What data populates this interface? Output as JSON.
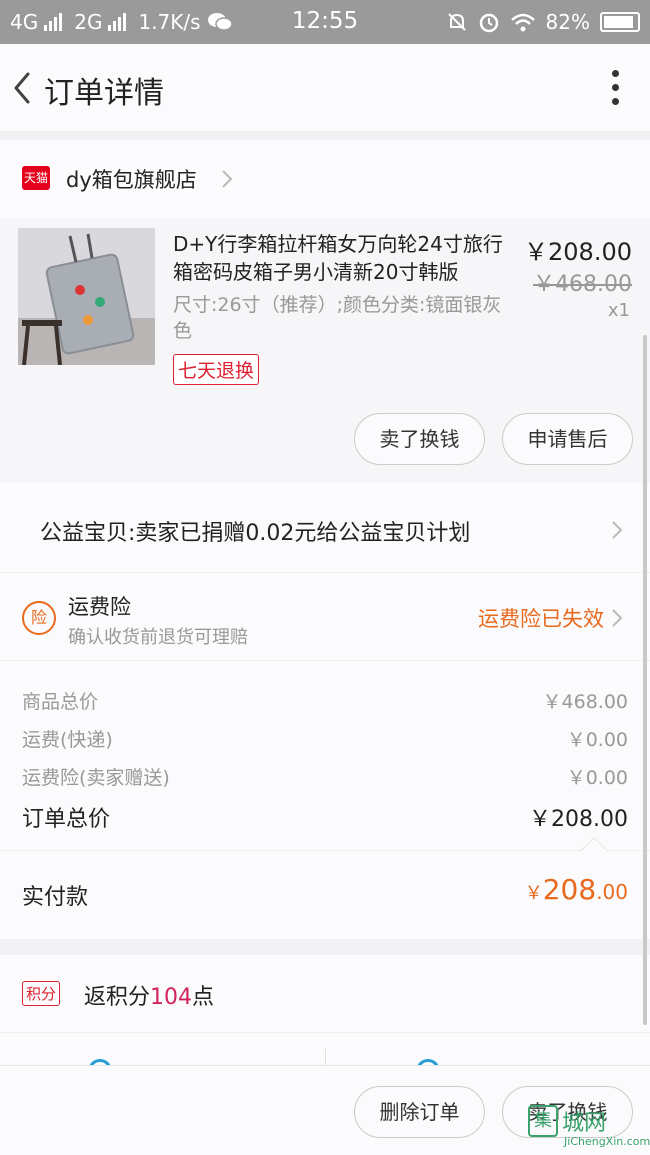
{
  "status_bar": {
    "net1": "4G",
    "net2": "2G",
    "speed": "1.7K/s",
    "time": "12:55",
    "battery": "82%"
  },
  "header": {
    "title": "订单详情"
  },
  "store": {
    "badge": "天猫",
    "name": "dy箱包旗舰店"
  },
  "product": {
    "title": "D+Y行李箱拉杆箱女万向轮24寸旅行箱密码皮箱子男小清新20寸韩版",
    "spec": "尺寸:26寸（推荐）;颜色分类:镜面银灰色",
    "tag": "七天退换",
    "price": "￥208.00",
    "original_price": "￥468.00",
    "qty": "x1",
    "btn_exchange": "卖了换钱",
    "btn_aftersale": "申请售后"
  },
  "charity": {
    "text": "公益宝贝:卖家已捐赠0.02元给公益宝贝计划"
  },
  "insurance": {
    "icon": "险",
    "title": "运费险",
    "subtitle": "确认收货前退货可理赔",
    "status": "运费险已失效"
  },
  "fees": {
    "goods_label": "商品总价",
    "goods_value": "￥468.00",
    "shipping_label": "运费(快递)",
    "shipping_value": "￥0.00",
    "insurance_label": "运费险(卖家赠送)",
    "insurance_value": "￥0.00",
    "total_label": "订单总价",
    "total_value": "￥208.00"
  },
  "paid": {
    "label": "实付款",
    "currency": "￥",
    "integer": "208",
    "decimal": ".00"
  },
  "points": {
    "badge": "积分",
    "prefix": "返积分",
    "number": "104",
    "suffix": "点"
  },
  "bottom_bar": {
    "delete_label": "删除订单",
    "exchange_label": "卖了换钱"
  },
  "watermark": {
    "box": "集",
    "text": "城网",
    "url": "JiChengXin.com"
  }
}
